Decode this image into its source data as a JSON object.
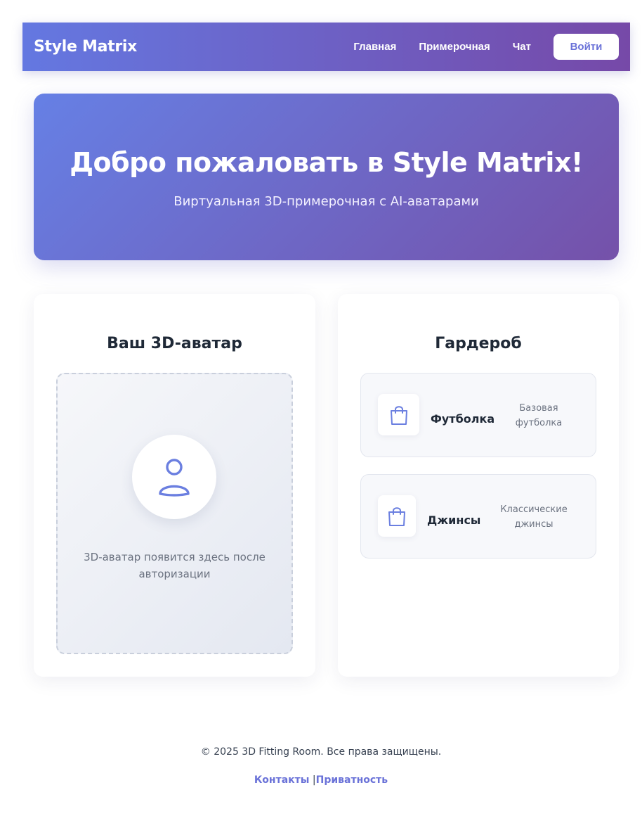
{
  "header": {
    "logo": "Style Matrix",
    "nav": [
      {
        "label": "Главная"
      },
      {
        "label": "Примерочная"
      },
      {
        "label": "Чат"
      }
    ],
    "login_label": "Войти"
  },
  "hero": {
    "title": "Добро пожаловать в Style Matrix!",
    "subtitle": "Виртуальная 3D-примерочная с AI-аватарами"
  },
  "avatar_card": {
    "title": "Ваш 3D-аватар",
    "placeholder_line1": "3D-аватар появится здесь после",
    "placeholder_line2": "авторизации",
    "icon": "user-icon"
  },
  "wardrobe": {
    "title": "Гардероб",
    "items": [
      {
        "name": "Футболка",
        "desc_line1": "Базовая",
        "desc_line2": "футболка",
        "icon": "shopping-bag-icon"
      },
      {
        "name": "Джинсы",
        "desc_line1": "Классические",
        "desc_line2": "джинсы",
        "icon": "shopping-bag-icon"
      }
    ]
  },
  "footer": {
    "copyright": "© 2025 3D Fitting Room. Все права защищены.",
    "links": [
      {
        "label": "Контакты"
      },
      {
        "label": "Приватность"
      }
    ],
    "separator": " |"
  },
  "colors": {
    "gradient_start": "#6478e1",
    "gradient_end": "#7649a8",
    "accent": "#6a72d8",
    "icon_stroke": "#6b7fe0"
  }
}
